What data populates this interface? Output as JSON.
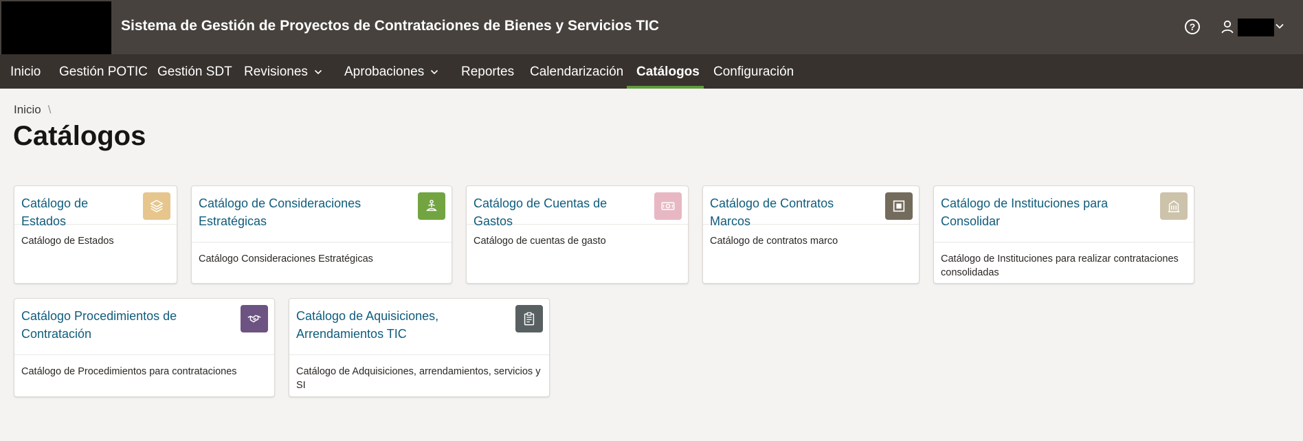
{
  "header": {
    "title": "Sistema de Gestión de Proyectos de Contrataciones de Bienes y Servicios TIC",
    "help_icon": "help-circle-icon",
    "user_icon": "user-icon",
    "chevron_icon": "chevron-down-icon"
  },
  "nav": {
    "items": [
      {
        "label": "Inicio"
      },
      {
        "label": "Gestión POTIC"
      },
      {
        "label": "Gestión SDT"
      },
      {
        "label": "Revisiones"
      },
      {
        "label": "Aprobaciones"
      },
      {
        "label": "Reportes"
      },
      {
        "label": "Calendarización"
      },
      {
        "label": "Catálogos"
      },
      {
        "label": "Configuración"
      }
    ],
    "active": "Catálogos",
    "active_color": "#5f9b3d"
  },
  "breadcrumb": {
    "home": "Inicio",
    "separator": "\\"
  },
  "page": {
    "title": "Catálogos"
  },
  "cards": [
    {
      "title": "Catálogo de Estados",
      "description": "Catálogo de Estados",
      "icon": "layers-icon",
      "color": "#e6c68c"
    },
    {
      "title": "Catálogo de Consideraciones Estratégicas",
      "description": "Catálogo Consideraciones Estratégicas",
      "icon": "yoga-icon",
      "color": "#72a541"
    },
    {
      "title": "Catálogo de Cuentas de Gastos",
      "description": "Catálogo de cuentas de gasto",
      "icon": "money-icon",
      "color": "#e7b8c3"
    },
    {
      "title": "Catálogo de Contratos Marcos",
      "description": "Catálogo de contratos marco",
      "icon": "square-frame-icon",
      "color": "#736b5c"
    },
    {
      "title": "Catálogo de Instituciones para Consolidar",
      "description": "Catálogo de Instituciones para realizar contrataciones consolidadas",
      "icon": "building-icon",
      "color": "#cdc3ab"
    },
    {
      "title": "Catálogo Procedimientos de Contratación",
      "description": "Catálogo de Procedimientos para contrataciones",
      "icon": "handshake-icon",
      "color": "#6c5382"
    },
    {
      "title": "Catálogo de Aquisiciones, Arrendamientos TIC",
      "description": "Catálogo de Adquisiciones, arrendamientos, servicios y SI",
      "icon": "clipboard-icon",
      "color": "#586061"
    }
  ]
}
